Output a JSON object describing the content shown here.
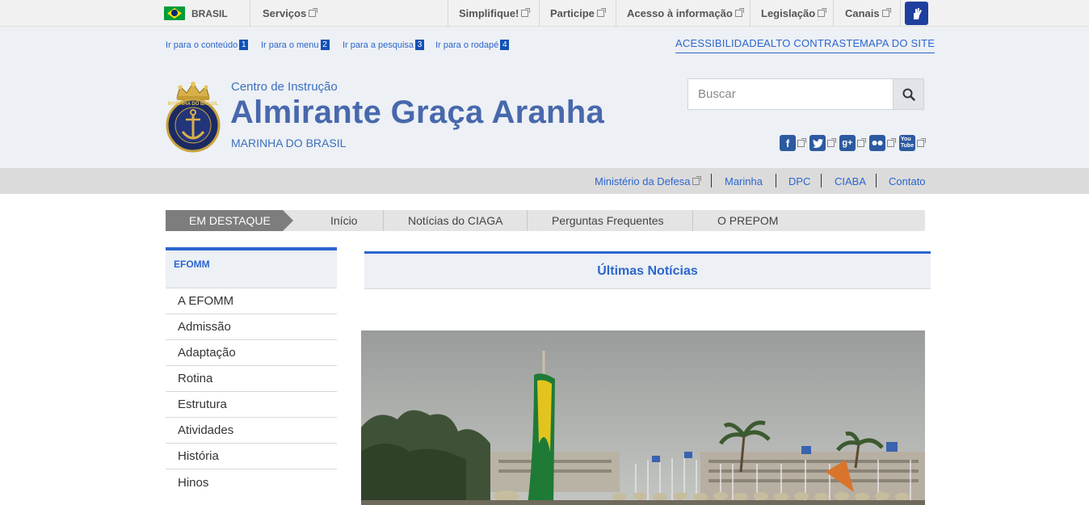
{
  "govbar": {
    "brand": "BRASIL",
    "services": "Serviços",
    "links": [
      "Simplifique!",
      "Participe",
      "Acesso à informação",
      "Legislação",
      "Canais"
    ]
  },
  "skiplinks": [
    {
      "label": "Ir para o conteúdo",
      "key": "1"
    },
    {
      "label": "Ir para o menu",
      "key": "2"
    },
    {
      "label": "Ir para a pesquisa",
      "key": "3"
    },
    {
      "label": "Ir para o rodapé",
      "key": "4"
    }
  ],
  "accessibility": {
    "acessibilidade": "ACESSIBILIDADE",
    "contraste": "ALTO CONTRASTE",
    "mapa": "MAPA DO SITE"
  },
  "header": {
    "pretitle": "Centro de Instrução",
    "title": "Almirante Graça Aranha",
    "subtitle": "MARINHA DO BRASIL",
    "logo_text": "MARINHA DO BRASIL"
  },
  "search": {
    "placeholder": "Buscar"
  },
  "social": [
    "facebook-icon",
    "twitter-icon",
    "google-plus-icon",
    "flickr-icon",
    "youtube-icon"
  ],
  "secbar": {
    "links": [
      "Ministério da Defesa",
      "Marinha",
      "DPC",
      "CIABA",
      "Contato"
    ]
  },
  "nav": {
    "highlight": "EM DESTAQUE",
    "items": [
      "Início",
      "Notícias do CIAGA",
      "Perguntas Frequentes",
      "O PREPOM"
    ]
  },
  "sidebar": {
    "heading": "EFOMM",
    "items": [
      "A EFOMM",
      "Admissão",
      "Adaptação",
      "Rotina",
      "Estrutura",
      "Atividades",
      "História",
      "Hinos"
    ]
  },
  "main": {
    "news_heading": "Últimas Notícias"
  },
  "colors": {
    "accent": "#2c66ce",
    "title": "#4868ad",
    "header_bg": "#edf0f4"
  }
}
